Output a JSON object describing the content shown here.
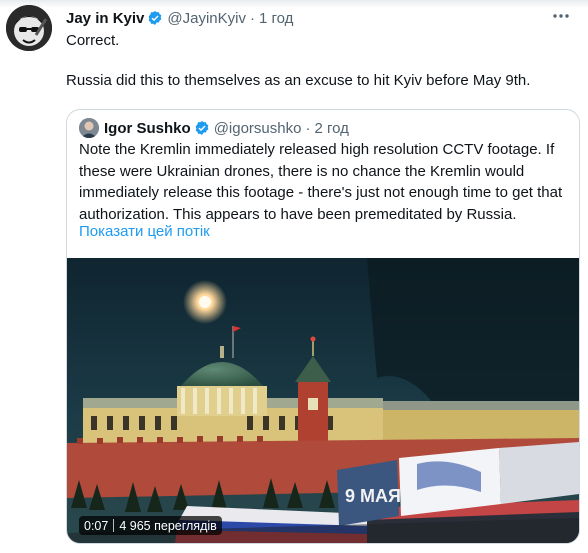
{
  "tweet": {
    "author_name": "Jay in Kyiv",
    "author_handle": "@JayinKyiv",
    "separator": "·",
    "time": "1 год",
    "line1": "Correct.",
    "line2": "Russia did this to themselves as an excuse to hit Kyiv before May 9th."
  },
  "quote": {
    "author_name": "Igor Sushko",
    "author_handle": "@igorsushko",
    "separator": "·",
    "time": "2 год",
    "text": "Note the Kremlin immediately released high resolution CCTV footage. If these were Ukrainian drones, there is no chance the Kremlin would immediately release this footage - there's just not enough time to get that authorization. This appears to have been premeditated by Russia.",
    "show_thread": "Показати цей потік",
    "video": {
      "duration": "0:07",
      "views": "4 965 переглядів",
      "billboard_text": "9 МАЯ"
    }
  },
  "icons": {
    "verified": "verified-badge-icon",
    "more": "more-options-icon"
  },
  "colors": {
    "verified": "#1d9bf0",
    "link": "#1d9bf0",
    "secondary_text": "#536471"
  }
}
